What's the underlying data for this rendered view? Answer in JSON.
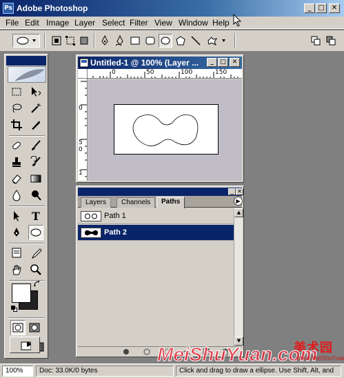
{
  "app": {
    "title": "Adobe Photoshop",
    "icon_label": "Ps",
    "window_controls": {
      "minimize": "_",
      "maximize": "□",
      "close": "✕"
    }
  },
  "menu": [
    "File",
    "Edit",
    "Image",
    "Layer",
    "Select",
    "Filter",
    "View",
    "Window",
    "Help"
  ],
  "options_bar": {
    "tool_preset": "ellipse-tool-icon",
    "buttons": [
      "shape-layers-icon",
      "paths-icon",
      "fill-pixels-icon",
      "pen-icon",
      "freeform-pen-icon",
      "rectangle-icon",
      "rounded-rectangle-icon",
      "ellipse-icon",
      "polygon-icon",
      "line-icon",
      "custom-shape-icon"
    ],
    "selected": "ellipse-icon"
  },
  "document": {
    "title": "Untitled-1 @ 100% (Layer ...",
    "ruler_h_labels": [
      "0",
      "50",
      "100",
      "150"
    ],
    "ruler_v_labels": [
      "0",
      "5",
      "0",
      "1"
    ],
    "controls": {
      "minimize": "_",
      "maximize": "□",
      "close": "✕"
    }
  },
  "paths_panel": {
    "tabs": [
      "Layers",
      "Channels",
      "Paths"
    ],
    "active_tab": "Paths",
    "menu_arrow": "▶",
    "paths": [
      {
        "label": "Path 1",
        "selected": false
      },
      {
        "label": "Path 2",
        "selected": true
      }
    ],
    "footer_icons": [
      "fill-path-icon",
      "stroke-path-icon",
      "load-selection-icon",
      "make-work-path-icon",
      "new-path-icon",
      "delete-path-icon"
    ],
    "controls": {
      "minimize": "_",
      "close": "✕"
    }
  },
  "status_bar": {
    "zoom": "100%",
    "doc_info": "Doc: 33.0K/0 bytes",
    "hint": "Click and drag to draw a ellipse. Use Shift, Alt, and"
  },
  "watermark": {
    "cn": "美术园",
    "en": "MeiShuYuan.com",
    "url": "www.MeiShuYuan.com"
  },
  "colors": {
    "title_start": "#0a246a",
    "title_end": "#a6caf0",
    "chrome": "#d4d0c8",
    "canvas_bg": "#c0bdc6",
    "selection": "#0a246a",
    "watermark_red": "#e01c1c"
  }
}
